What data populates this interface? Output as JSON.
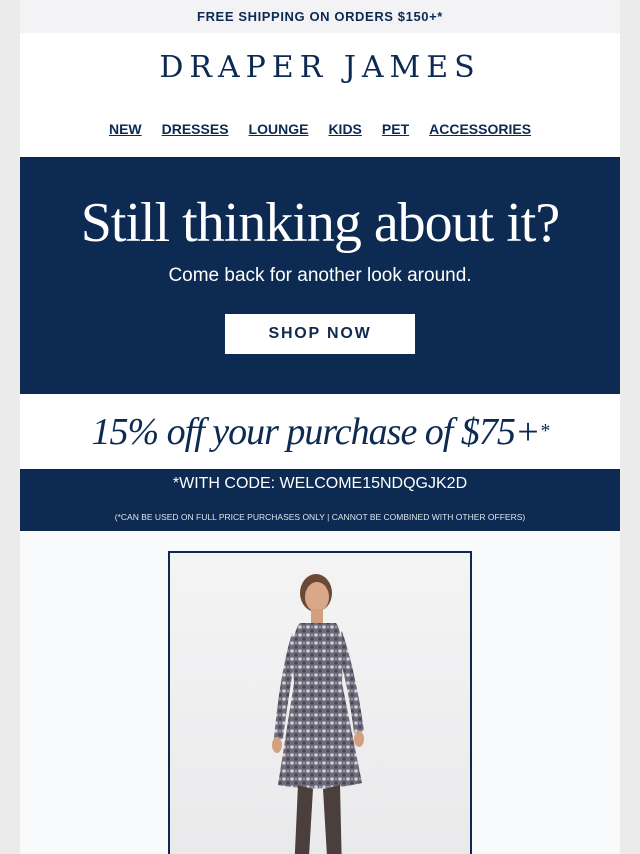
{
  "topbar": {
    "text": "FREE SHIPPING ON ORDERS $150+*"
  },
  "brand": {
    "name": "DRAPER JAMES"
  },
  "nav": {
    "items": [
      {
        "label": "NEW"
      },
      {
        "label": "DRESSES"
      },
      {
        "label": "LOUNGE"
      },
      {
        "label": "KIDS"
      },
      {
        "label": "PET"
      },
      {
        "label": "ACCESSORIES"
      }
    ]
  },
  "hero": {
    "headline": "Still thinking about it?",
    "subhead": "Come back for another look around.",
    "cta": "SHOP NOW"
  },
  "promo": {
    "offer": "15% off your purchase of $75+",
    "asterisk": "*"
  },
  "code": {
    "line": "*WITH CODE: WELCOME15NDQGJK2D",
    "fine_print": "(*CAN BE USED ON FULL PRICE PURCHASES ONLY | CANNOT BE COMBINED WITH OTHER OFFERS)"
  },
  "colors": {
    "navy": "#0c2a52",
    "white": "#ffffff",
    "light_bg": "#f3f3f5"
  },
  "product": {
    "image": "sequin-dress-model-photo"
  }
}
